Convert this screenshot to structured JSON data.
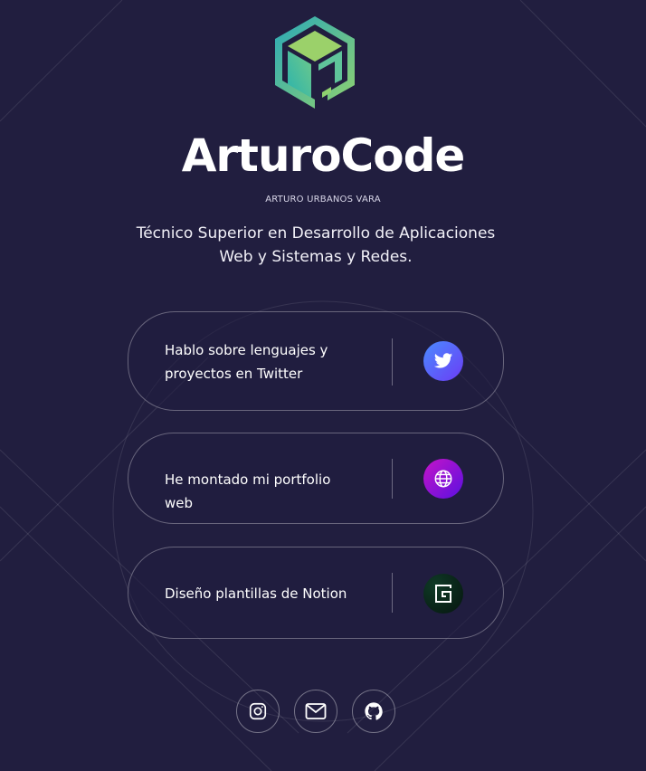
{
  "brand": {
    "name": "ArturoCode",
    "full_name": "ARTURO URBANOS VARA",
    "tagline": "Técnico Superior en Desarrollo de Aplicaciones Web y Sistemas y Redes."
  },
  "links": [
    {
      "label": "Hablo sobre lenguajes y proyectos en Twitter",
      "icon": "twitter-icon"
    },
    {
      "label": "He montado mi portfolio web",
      "icon": "globe-icon"
    },
    {
      "label": "Diseño plantillas de Notion",
      "icon": "notion-icon"
    }
  ],
  "social": [
    {
      "icon": "instagram-icon"
    },
    {
      "icon": "mail-icon"
    },
    {
      "icon": "github-icon"
    }
  ],
  "colors": {
    "background": "#211e3f",
    "text": "#ffffff",
    "logo_teal": "#2bb3ad",
    "logo_green": "#8fd16f",
    "twitter_gradient": [
      "#4a8bff",
      "#6b3cf5"
    ],
    "web_gradient": [
      "#c514c8",
      "#5a10e0"
    ],
    "notion_bg": "#06150f"
  }
}
